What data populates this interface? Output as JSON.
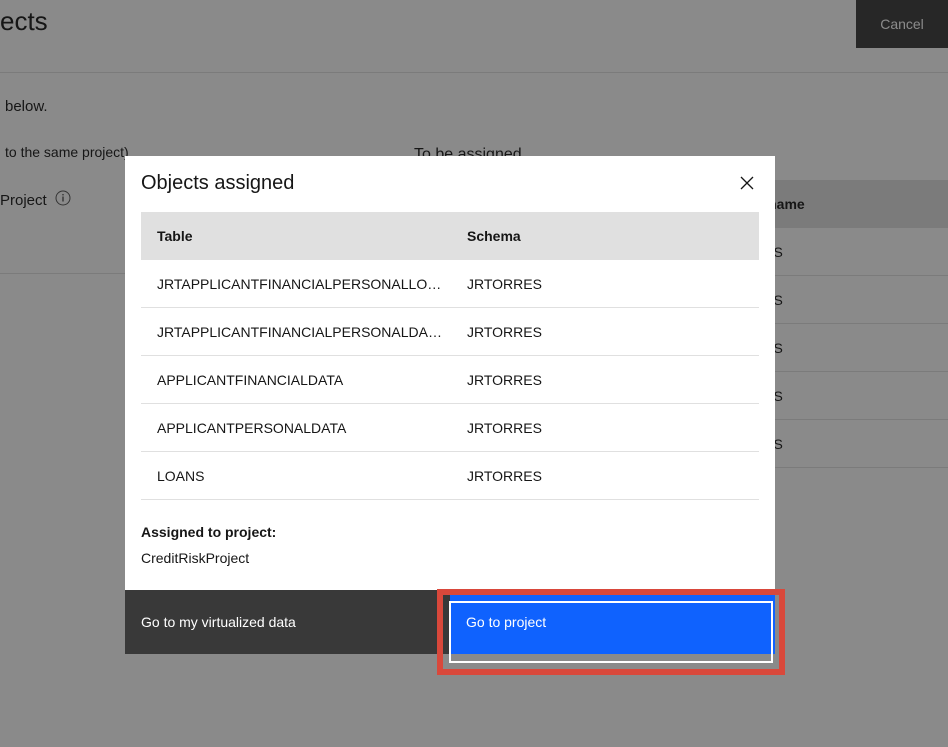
{
  "background": {
    "title_truncated": "ects",
    "cancel": "Cancel",
    "below_text": " below.",
    "same_project_text": " to the same project)",
    "to_be_assigned": "To be assigned",
    "project_label": "Project",
    "schema_header_truncated": "ma name",
    "schema_value_truncated": "RRES"
  },
  "modal": {
    "title": "Objects assigned",
    "headers": {
      "table": "Table",
      "schema": "Schema"
    },
    "rows": [
      {
        "table": "JRTAPPLICANTFINANCIALPERSONALLO…",
        "schema": "JRTORRES"
      },
      {
        "table": "JRTAPPLICANTFINANCIALPERSONALDA…",
        "schema": "JRTORRES"
      },
      {
        "table": "APPLICANTFINANCIALDATA",
        "schema": "JRTORRES"
      },
      {
        "table": "APPLICANTPERSONALDATA",
        "schema": "JRTORRES"
      },
      {
        "table": "LOANS",
        "schema": "JRTORRES"
      }
    ],
    "assigned_label": "Assigned to project:",
    "assigned_project": "CreditRiskProject",
    "buttons": {
      "secondary": "Go to my virtualized data",
      "primary": "Go to project"
    }
  }
}
